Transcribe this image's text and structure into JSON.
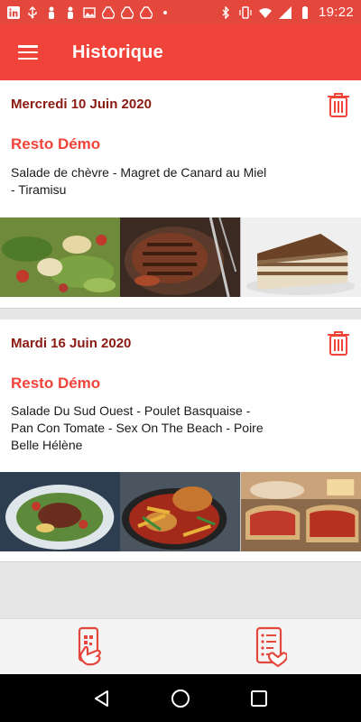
{
  "status_bar": {
    "time": "19:22",
    "left_icons": [
      "linkedin-icon",
      "usb-icon",
      "person-icon",
      "person-icon",
      "image-icon",
      "drive-icon",
      "drive-icon",
      "drive-icon",
      "dot-icon"
    ],
    "right_icons": [
      "bluetooth-icon",
      "vibrate-icon",
      "wifi-icon",
      "signal-icon",
      "battery-icon"
    ]
  },
  "app_bar": {
    "title": "Historique",
    "menu_icon": "hamburger-menu-icon",
    "color": "#f0443a"
  },
  "orders": [
    {
      "date": "Mercredi 10 Juin 2020",
      "restaurant": "Resto Démo",
      "menu": "Salade de chèvre - Magret de Canard au Miel - Tiramisu",
      "photos": [
        "salad-photo",
        "duck-breast-photo",
        "tiramisu-photo"
      ]
    },
    {
      "date": "Mardi 16 Juin 2020",
      "restaurant": "Resto Démo",
      "menu": "Salade Du Sud Ouest - Poulet Basquaise - Pan Con Tomate - Sex On The Beach - Poire Belle Hélène",
      "photos": [
        "southwest-salad-photo",
        "basque-chicken-photo",
        "pan-con-tomate-photo"
      ]
    }
  ],
  "bottom_bar": {
    "items": [
      "scan-phone-icon",
      "order-list-heart-icon"
    ]
  },
  "nav_bar": {
    "items": [
      "back-icon",
      "home-icon",
      "recents-icon"
    ]
  },
  "colors": {
    "accent": "#f0443a",
    "date": "#8a1a12",
    "background": "#e6e6e6"
  }
}
